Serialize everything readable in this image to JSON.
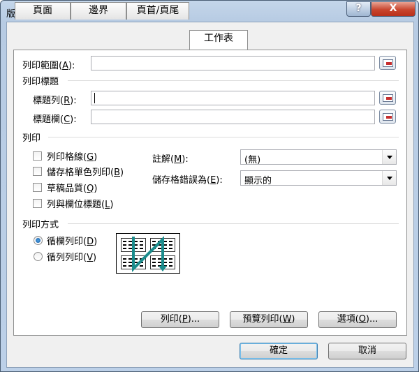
{
  "window": {
    "title": "版面設定",
    "help_label": "?",
    "close_label": "X"
  },
  "tabs": [
    {
      "label": "頁面",
      "active": false
    },
    {
      "label": "邊界",
      "active": false
    },
    {
      "label": "頁首/頁尾",
      "active": false
    },
    {
      "label": "工作表",
      "active": true
    }
  ],
  "print_area": {
    "label": "列印範圍(",
    "key": "A",
    "suffix": "):",
    "value": ""
  },
  "print_titles": {
    "heading": "列印標題",
    "rows": {
      "label": "標題列(",
      "key": "R",
      "suffix": "):",
      "value": ""
    },
    "columns": {
      "label": "標題欄(",
      "key": "C",
      "suffix": "):",
      "value": ""
    }
  },
  "print": {
    "heading": "列印",
    "checkboxes": [
      {
        "label": "列印格線(",
        "key": "G",
        "suffix": ")",
        "checked": false
      },
      {
        "label": "儲存格單色列印(",
        "key": "B",
        "suffix": ")",
        "checked": false
      },
      {
        "label": "草稿品質(",
        "key": "Q",
        "suffix": ")",
        "checked": false
      },
      {
        "label": "列與欄位標題(",
        "key": "L",
        "suffix": ")",
        "checked": false
      }
    ],
    "comments": {
      "label": "註解(",
      "key": "M",
      "suffix": "):",
      "value": "(無)"
    },
    "cell_errors": {
      "label": "儲存格錯誤為(",
      "key": "E",
      "suffix": "):",
      "value": "顯示的"
    }
  },
  "page_order": {
    "heading": "列印方式",
    "options": [
      {
        "label": "循欄列印(",
        "key": "D",
        "suffix": ")",
        "selected": true
      },
      {
        "label": "循列列印(",
        "key": "V",
        "suffix": ")",
        "selected": false
      }
    ]
  },
  "buttons": {
    "print": {
      "label": "列印(",
      "key": "P",
      "suffix": ")..."
    },
    "preview": {
      "label": "預覽列印(",
      "key": "W",
      "suffix": ")"
    },
    "options": {
      "label": "選項(",
      "key": "O",
      "suffix": ")..."
    },
    "ok": "確定",
    "cancel": "取消"
  },
  "colors": {
    "accent": "#1a5fa8",
    "arrow": "#1b8c8c",
    "close": "#c8452e"
  }
}
